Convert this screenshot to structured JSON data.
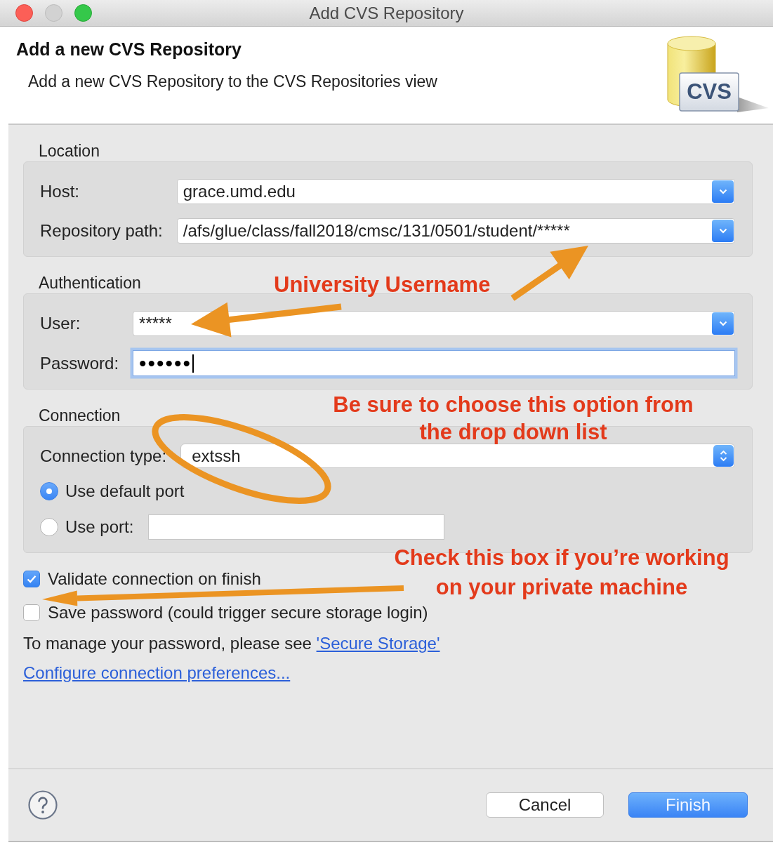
{
  "window": {
    "title": "Add CVS Repository",
    "controls": [
      {
        "kind": "close",
        "disabled": false
      },
      {
        "kind": "minimize",
        "disabled": true
      },
      {
        "kind": "zoom",
        "disabled": false
      }
    ]
  },
  "header": {
    "title": "Add a new CVS Repository",
    "description": "Add a new CVS Repository to the CVS Repositories view",
    "logo_text": "CVS"
  },
  "groups": [
    {
      "heading": "Location",
      "rows": [
        {
          "kind": "combo",
          "label": "Host:",
          "value": "grace.umd.edu"
        },
        {
          "kind": "combo",
          "label": "Repository path:",
          "value": "/afs/glue/class/fall2018/cmsc/131/0501/student/*****"
        }
      ]
    },
    {
      "heading": "Authentication",
      "rows": [
        {
          "kind": "combo",
          "label": "User:",
          "value": "*****"
        },
        {
          "kind": "password",
          "label": "Password:",
          "value": "••••••",
          "focused": true
        }
      ]
    },
    {
      "heading": "Connection",
      "rows": [
        {
          "kind": "select",
          "label": "Connection type:",
          "value": "extssh"
        },
        {
          "kind": "radio",
          "label": "Use default port",
          "selected": true
        },
        {
          "kind": "radio_field",
          "label": "Use port:",
          "selected": false
        }
      ]
    }
  ],
  "options": [
    {
      "label": "Validate connection on finish",
      "checked": true
    },
    {
      "label": "Save password (could trigger secure storage login)",
      "checked": false
    }
  ],
  "password_note": {
    "text": "To manage your password, please see",
    "link": "'Secure Storage'"
  },
  "preferences_link": "Configure connection preferences...",
  "buttons": [
    {
      "label": "Cancel",
      "kind": "default"
    },
    {
      "label": "Finish",
      "kind": "primary"
    }
  ],
  "annotations": [
    {
      "lines": [
        "University Username"
      ]
    },
    {
      "lines": [
        "Be sure to choose this option from",
        "the drop down list"
      ]
    },
    {
      "lines": [
        "Check this box if you’re working",
        "on your private machine"
      ]
    }
  ]
}
